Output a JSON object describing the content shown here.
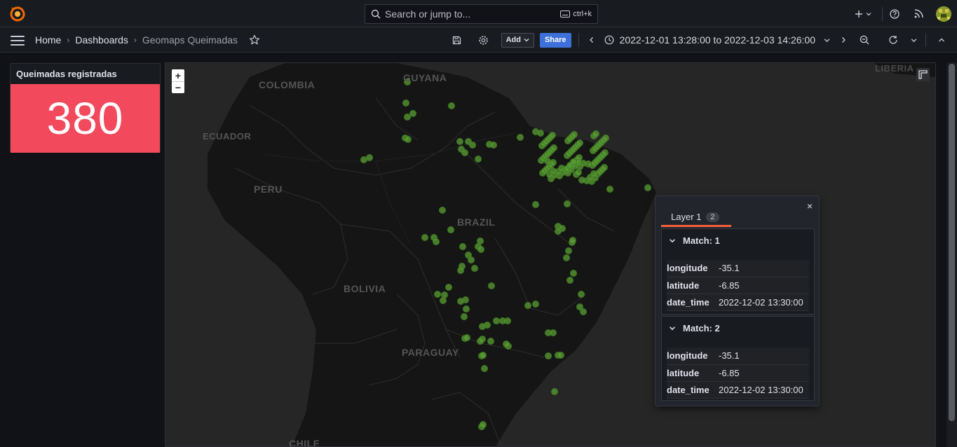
{
  "topbar": {
    "search_placeholder": "Search or jump to...",
    "shortcut": "ctrl+k",
    "icons": [
      "grafana-logo",
      "plus-icon",
      "help-icon",
      "rss-icon",
      "avatar"
    ]
  },
  "navbar": {
    "breadcrumbs": [
      "Home",
      "Dashboards",
      "Geomaps Queimadas"
    ],
    "add_label": "Add",
    "share_label": "Share",
    "time_range": "2022-12-01 13:28:00 to 2022-12-03 14:26:00"
  },
  "stat_panel": {
    "title": "Queimadas registradas",
    "value": "380",
    "color": "#f2495c"
  },
  "map": {
    "zoom_in": "+",
    "zoom_out": "−",
    "labels": [
      "COLOMBIA",
      "GUYANA",
      "ECUADOR",
      "PERU",
      "BRAZIL",
      "BOLIVIA",
      "PARAGUAY",
      "CHILE",
      "LIBERIA"
    ],
    "point_color": "#5a9e34"
  },
  "tooltip": {
    "close": "×",
    "layer_tab": "Layer 1",
    "count": "2",
    "matches": [
      {
        "title": "Match: 1",
        "rows": [
          [
            "longitude",
            "-35.1"
          ],
          [
            "latitude",
            "-6.85"
          ],
          [
            "date_time",
            "2022-12-02 13:30:00"
          ]
        ]
      },
      {
        "title": "Match: 2",
        "rows": [
          [
            "longitude",
            "-35.1"
          ],
          [
            "latitude",
            "-6.85"
          ],
          [
            "date_time",
            "2022-12-02 13:30:00"
          ]
        ]
      }
    ]
  }
}
